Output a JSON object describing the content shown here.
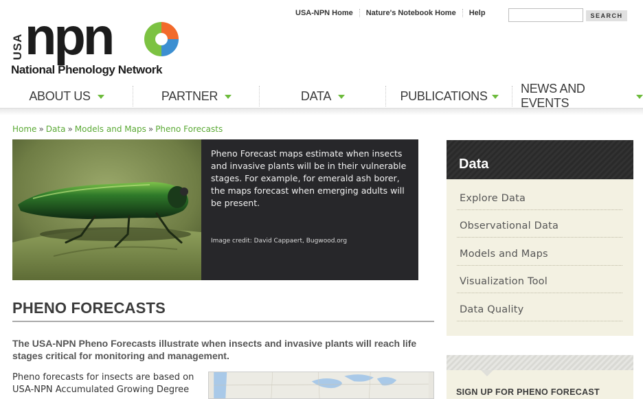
{
  "logo": {
    "usa": "USA",
    "npn": "npn",
    "tagline": "National Phenology Network"
  },
  "toplinks": [
    "USA-NPN Home",
    "Nature's Notebook Home",
    "Help"
  ],
  "search": {
    "placeholder": "",
    "button": "SEARCH"
  },
  "nav": [
    {
      "label": "ABOUT US"
    },
    {
      "label": "PARTNER"
    },
    {
      "label": "DATA"
    },
    {
      "label": "PUBLICATIONS"
    },
    {
      "label": "NEWS AND EVENTS"
    }
  ],
  "breadcrumb": [
    "Home",
    "Data",
    "Models and Maps",
    "Pheno Forecasts"
  ],
  "hero": {
    "caption": "Pheno Forecast maps estimate when insects and invasive plants will be in their vulnerable stages. For example, for emerald ash borer, the maps forecast when emerging adults will be present.",
    "credit": "Image credit: David Cappaert, Bugwood.org"
  },
  "page": {
    "title": "PHENO FORECASTS",
    "intro": "The USA-NPN Pheno Forecasts illustrate when insects and invasive plants will reach life stages critical for monitoring and management.",
    "paragraph": "Pheno forecasts for insects are based on USA-NPN Accumulated Growing Degree"
  },
  "sidebar": {
    "title": "Data",
    "items": [
      "Explore Data",
      "Observational Data",
      "Models and Maps",
      "Visualization Tool",
      "Data Quality"
    ]
  },
  "signup": {
    "title": "SIGN UP FOR PHENO FORECAST"
  },
  "colors": {
    "accent": "#6dbb3c",
    "link": "#5aa934",
    "dark": "#27272a",
    "sidebar_bg": "#f3f1e2"
  },
  "icons": {
    "logo": "npn-swirl-logo-icon",
    "nav_arrow": "triangle-down-icon"
  }
}
